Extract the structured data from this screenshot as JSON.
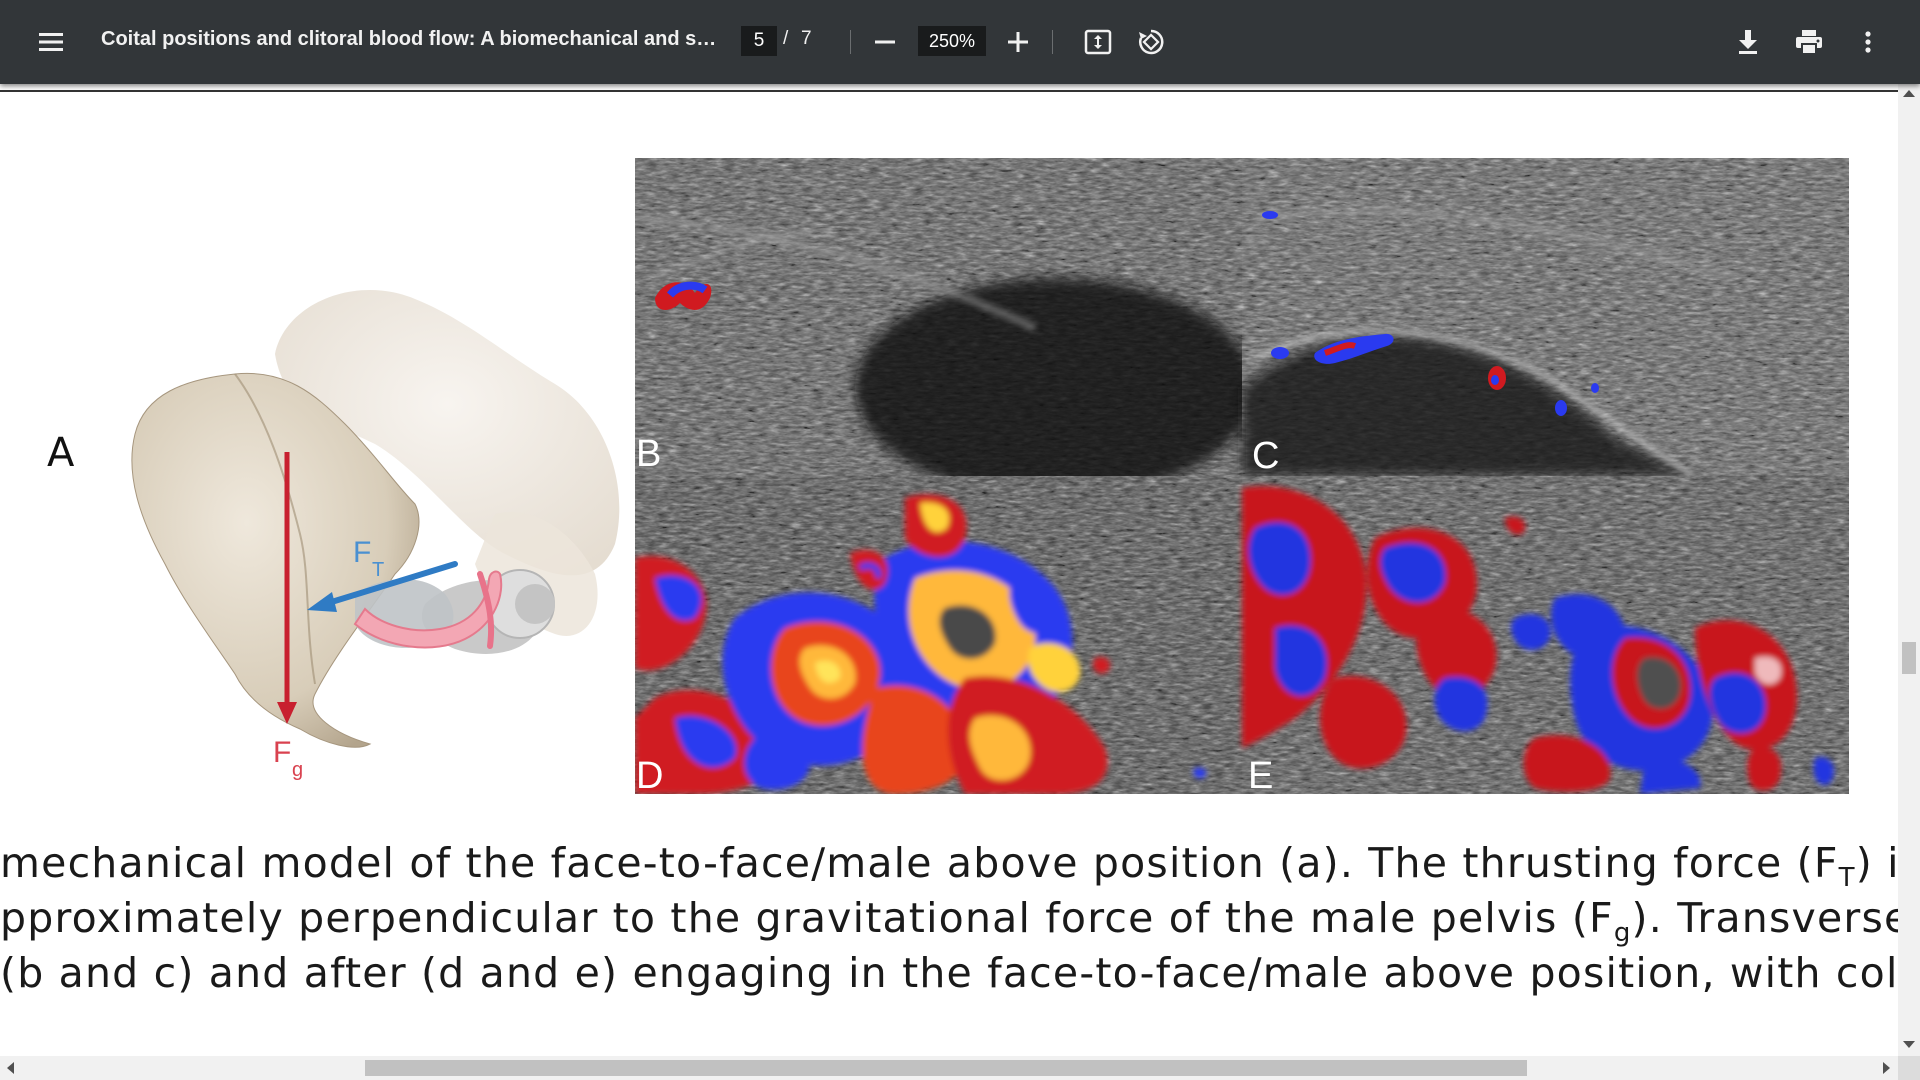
{
  "toolbar": {
    "title": "Coital positions and clitoral blood flow: A biomechanical and so...",
    "current_page": "5",
    "page_separator": "/",
    "total_pages": "7",
    "zoom": "250%",
    "icons": [
      "menu-icon",
      "minus-icon",
      "plus-icon",
      "fit-page-icon",
      "rotate-icon",
      "download-icon",
      "print-icon",
      "more-vert-icon"
    ]
  },
  "figure": {
    "label_a": "A",
    "force_thrust": "F",
    "force_thrust_sub": "T",
    "force_gravity": "F",
    "force_gravity_sub": "g",
    "panel_b": "B",
    "panel_c": "C",
    "panel_d": "D",
    "panel_e": "E"
  },
  "caption": {
    "line1_a": "mechanical model of the face-to-face/male above position (a). The thrusting force (F",
    "line1_sub": "T",
    "line1_b": ") is provid",
    "line2_a": "pproximately perpendicular to the gravitational force of the male pelvis (F",
    "line2_sub": "g",
    "line2_b": "). Transverse and sagit",
    "line3": "(b and c) and after (d and e) engaging in the face-to-face/male above position, with color Doppler f"
  },
  "colors": {
    "toolbar_bg": "#323639",
    "thrust_arrow": "#2f7bc4",
    "gravity_arrow": "#c8202f",
    "doppler_red": "#c8161d",
    "doppler_blue": "#2035e0",
    "doppler_yellow": "#ffd23a"
  }
}
